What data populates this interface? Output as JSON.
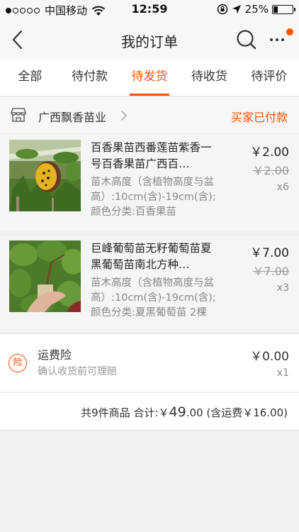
{
  "status_bar": {
    "carrier": "中国移动",
    "time": "12:59",
    "battery": "25%",
    "battery_level": 0.25
  },
  "nav": {
    "title": "我的订单",
    "icons": [
      "back-arrow-icon",
      "search-icon",
      "more-icon"
    ]
  },
  "tabs": [
    {
      "label": "全部",
      "active": false
    },
    {
      "label": "待付款",
      "active": false
    },
    {
      "label": "待发货",
      "active": true
    },
    {
      "label": "待收货",
      "active": false
    },
    {
      "label": "待评价",
      "active": false
    }
  ],
  "shop": {
    "name": "广西飘香苗业",
    "status": "买家已付款"
  },
  "products": [
    {
      "title": "百香果苗西番莲苗紫香一号百香果苗广西百…",
      "spec": "苗木高度（含植物高度与盆高）:10cm(含)-19cm(含);颜色分类:百香果苗",
      "price": "￥2.00",
      "original_price": "￥2.00",
      "quantity": "x6"
    },
    {
      "title": "巨峰葡萄苗无籽葡萄苗夏黑葡萄苗南北方种…",
      "spec": "苗木高度（含植物高度与盆高）:10cm(含)-19cm(含);颜色分类:夏黑葡萄苗 2棵",
      "price": "￥7.00",
      "original_price": "￥7.00",
      "quantity": "x3"
    }
  ],
  "insurance": {
    "icon_text": "险",
    "title": "运费险",
    "desc": "确认收货前可理赔",
    "price": "￥0.00",
    "quantity": "x1"
  },
  "summary": {
    "count_text": "共9件商品",
    "total_label": "合计:",
    "currency": "￥",
    "total_int": "49",
    "total_dec": ".00",
    "shipping_note": "(含运费￥16.00)"
  },
  "colors": {
    "accent": "#ff5000"
  }
}
